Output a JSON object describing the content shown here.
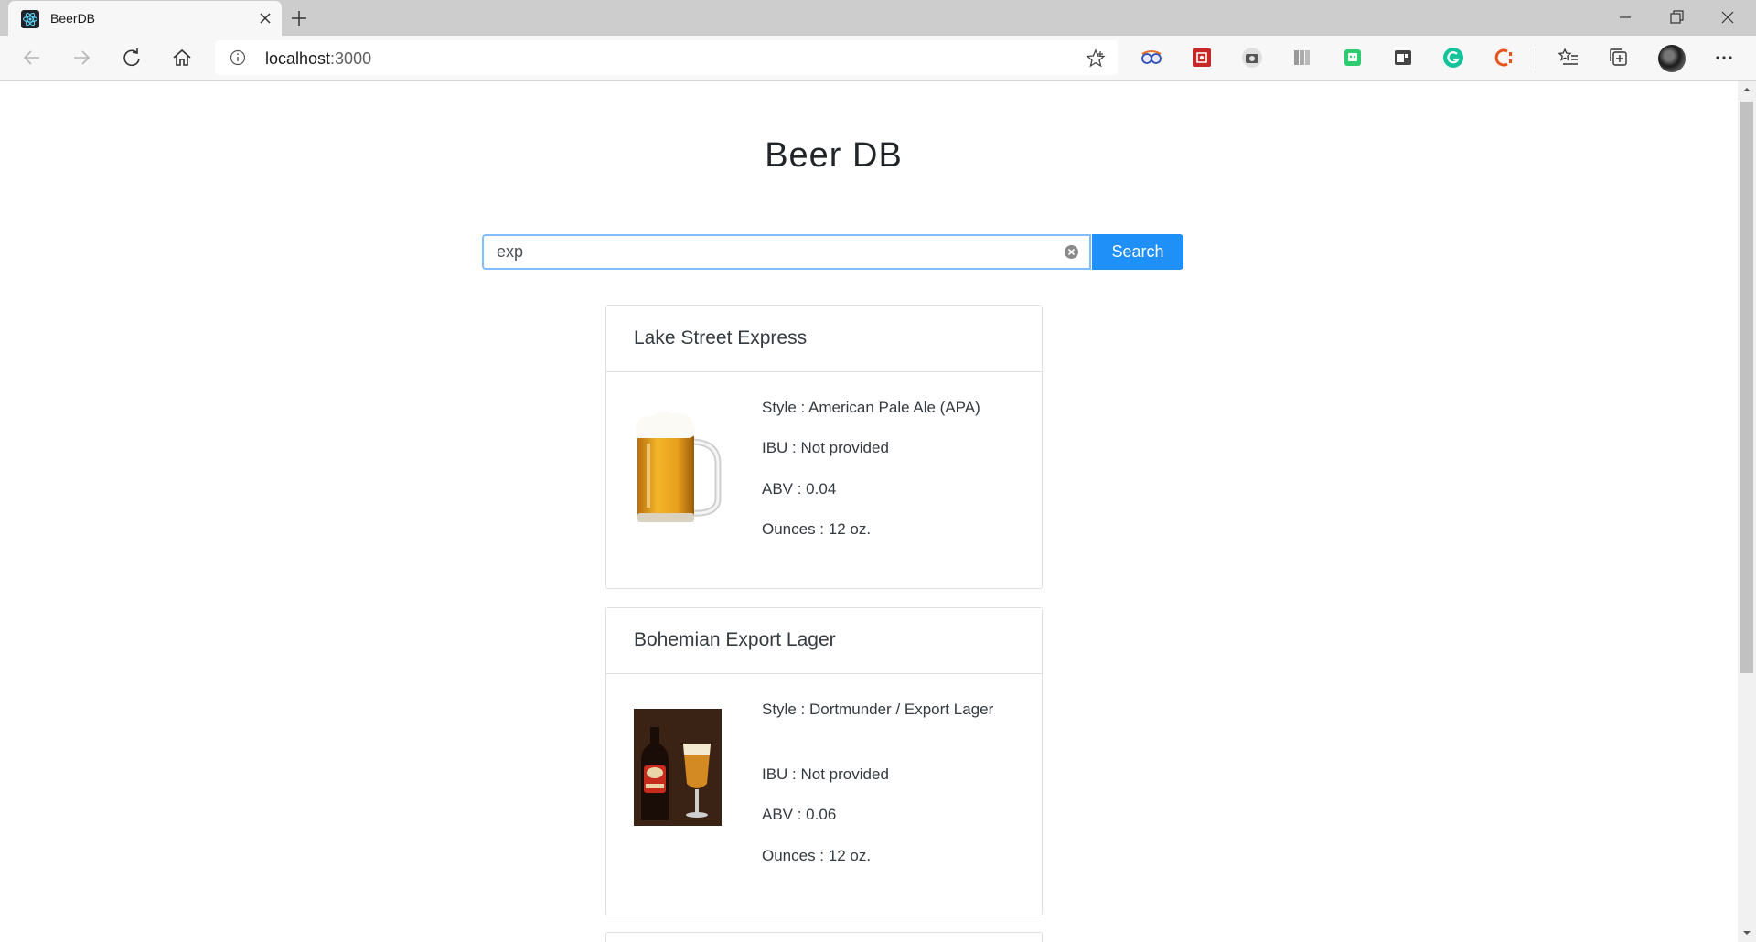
{
  "browser": {
    "tab_title": "BeerDB",
    "url_host": "localhost",
    "url_port": ":3000"
  },
  "page": {
    "title": "Beer DB",
    "search": {
      "value": "exp",
      "button_label": "Search"
    }
  },
  "results": [
    {
      "name": "Lake Street Express",
      "image": "beer-mug-icon",
      "style": "Style : American Pale Ale (APA)",
      "ibu": "IBU : Not provided",
      "abv": "ABV : 0.04",
      "ounces": "Ounces : 12 oz."
    },
    {
      "name": "Bohemian Export Lager",
      "image": "bottle-and-glass-photo",
      "style": "Style : Dortmunder / Export Lager",
      "ibu": "IBU : Not provided",
      "abv": "ABV : 0.06",
      "ounces": "Ounces : 12 oz."
    }
  ],
  "colors": {
    "accent": "#1e90f8",
    "focus_border": "#80bdff",
    "tabstrip": "#cdcdcd"
  }
}
